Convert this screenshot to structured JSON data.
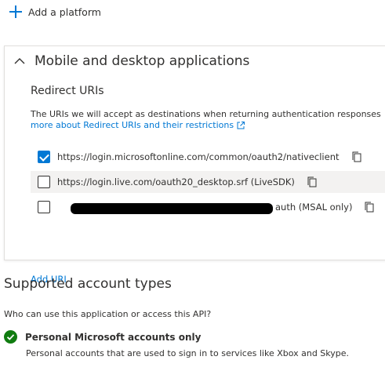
{
  "add_platform": {
    "label": "Add a platform",
    "icon": "plus-icon"
  },
  "mobile_desktop": {
    "title": "Mobile and desktop applications",
    "expanded": true,
    "redirect_uris": {
      "heading": "Redirect URIs",
      "description": "The URIs we will accept as destinations when returning authentication responses",
      "learn_more": "more about Redirect URIs and their restrictions",
      "items": [
        {
          "uri": "https://login.microsoftonline.com/common/oauth2/nativeclient",
          "checked": true
        },
        {
          "uri": "https://login.live.com/oauth20_desktop.srf (LiveSDK)",
          "checked": false
        },
        {
          "uri": "auth (MSAL only)",
          "checked": false,
          "redacted": true
        }
      ],
      "add_uri": "Add URI"
    }
  },
  "supported_accounts": {
    "heading": "Supported account types",
    "question": "Who can use this application or access this API?",
    "selected": {
      "title": "Personal Microsoft accounts only",
      "description": "Personal accounts that are used to sign in to services like Xbox and Skype."
    }
  },
  "colors": {
    "accent": "#0078d4",
    "success": "#107c10",
    "text": "#323130"
  }
}
